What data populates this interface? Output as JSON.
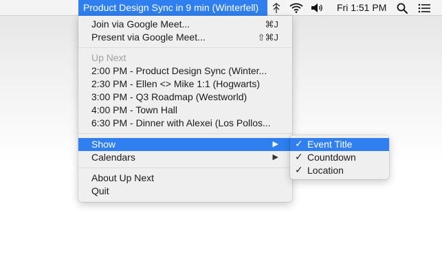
{
  "menubar": {
    "app_title": "Product Design Sync in 9 min (Winterfell)",
    "clock": "Fri 1:51 PM",
    "icons": [
      "upnext-logo-icon",
      "wifi-icon",
      "volume-icon",
      "spotlight-search-icon",
      "notification-center-icon"
    ]
  },
  "menu": {
    "actions": [
      {
        "label": "Join via Google Meet...",
        "shortcut": "⌘J"
      },
      {
        "label": "Present via Google Meet...",
        "shortcut": "⇧⌘J"
      }
    ],
    "upnext_header": "Up Next",
    "events": [
      "2:00 PM - Product Design Sync (Winter...",
      "2:30 PM - Ellen <> Mike 1:1 (Hogwarts)",
      "3:00 PM - Q3 Roadmap (Westworld)",
      "4:00 PM - Town Hall",
      "6:30 PM - Dinner with Alexei (Los Pollos..."
    ],
    "show_label": "Show",
    "calendars_label": "Calendars",
    "about_label": "About Up Next",
    "quit_label": "Quit",
    "submenu_arrow": "▶"
  },
  "submenu": {
    "check_glyph": "✓",
    "items": [
      "Event Title",
      "Countdown",
      "Location"
    ]
  },
  "colors": {
    "accent": "#2f7ff0",
    "menu_bg": "#efefef"
  }
}
